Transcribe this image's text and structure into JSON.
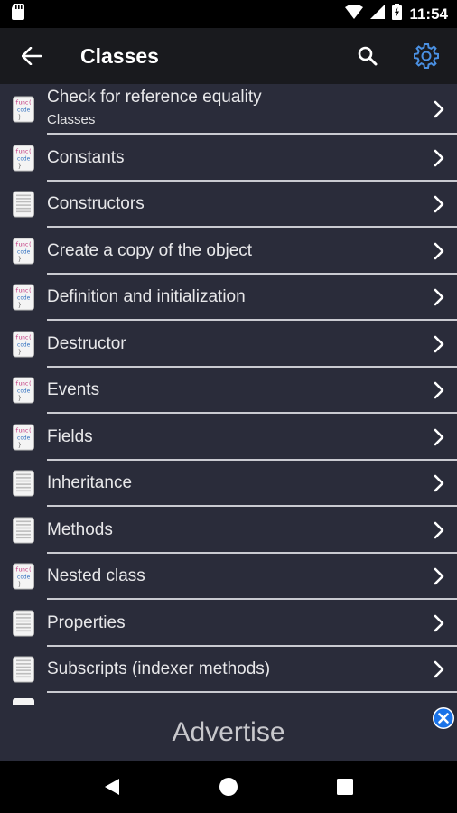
{
  "status_bar": {
    "time": "11:54"
  },
  "app_bar": {
    "title": "Classes"
  },
  "items": [
    {
      "label": "Check for reference equality",
      "subtitle": "Classes",
      "icon": "code-file-icon"
    },
    {
      "label": "Constants",
      "icon": "code-file-icon"
    },
    {
      "label": "Constructors",
      "icon": "text-file-icon"
    },
    {
      "label": "Create a copy of the object",
      "icon": "code-file-icon"
    },
    {
      "label": "Definition and initialization",
      "icon": "code-file-icon"
    },
    {
      "label": "Destructor",
      "icon": "code-file-icon"
    },
    {
      "label": "Events",
      "icon": "code-file-icon"
    },
    {
      "label": "Fields",
      "icon": "code-file-icon"
    },
    {
      "label": "Inheritance",
      "icon": "text-file-icon"
    },
    {
      "label": "Methods",
      "icon": "text-file-icon"
    },
    {
      "label": "Nested class",
      "icon": "code-file-icon"
    },
    {
      "label": "Properties",
      "icon": "text-file-icon"
    },
    {
      "label": "Subscripts (indexer methods)",
      "icon": "text-file-icon"
    }
  ],
  "ad": {
    "text": "Advertise"
  },
  "colors": {
    "accent": "#4a90e2",
    "background": "#2a2c3a",
    "app_bar": "#191a1e"
  }
}
